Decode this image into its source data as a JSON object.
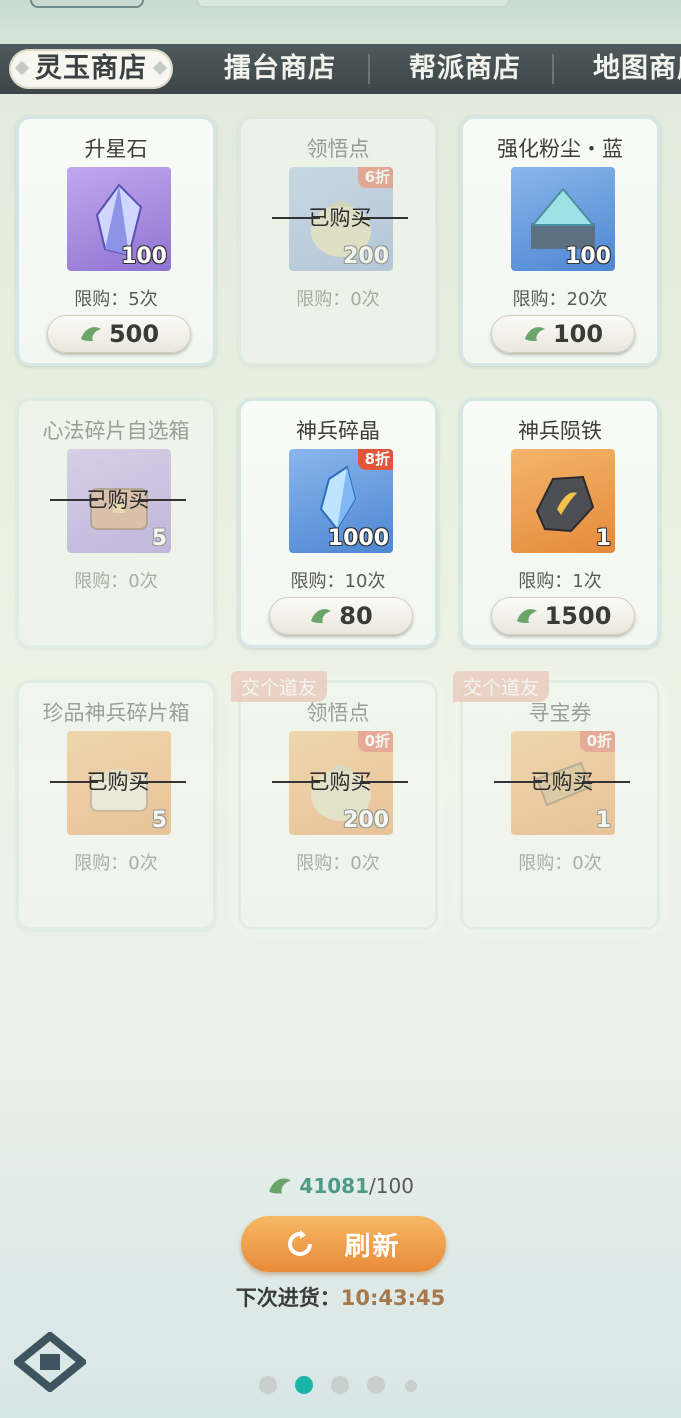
{
  "tabs": [
    {
      "label": "灵玉商店",
      "active": true
    },
    {
      "label": "擂台商店",
      "active": false
    },
    {
      "label": "帮派商店",
      "active": false
    },
    {
      "label": "地图商店",
      "active": false
    }
  ],
  "items": [
    {
      "name": "升星石",
      "qty": "100",
      "limit": "限购：5次",
      "price": "500",
      "discount": "",
      "sold_out": false,
      "icon": "crystal-icon"
    },
    {
      "name": "领悟点",
      "qty": "200",
      "limit": "限购：0次",
      "price": "",
      "discount": "6折",
      "sold_out": true,
      "icon": "pouch-icon"
    },
    {
      "name": "强化粉尘・蓝",
      "qty": "100",
      "limit": "限购：20次",
      "price": "100",
      "discount": "",
      "sold_out": false,
      "icon": "dust-box-icon"
    },
    {
      "name": "心法碎片自选箱",
      "qty": "5",
      "limit": "限购：0次",
      "price": "",
      "discount": "",
      "sold_out": true,
      "icon": "chest-icon"
    },
    {
      "name": "神兵碎晶",
      "qty": "1000",
      "limit": "限购：10次",
      "price": "80",
      "discount": "8折",
      "sold_out": false,
      "icon": "blue-crystal-icon"
    },
    {
      "name": "神兵陨铁",
      "qty": "1",
      "limit": "限购：1次",
      "price": "1500",
      "discount": "",
      "sold_out": false,
      "icon": "meteor-iron-icon"
    },
    {
      "name": "珍品神兵碎片箱",
      "qty": "5",
      "limit": "限购：0次",
      "price": "",
      "discount": "",
      "sold_out": true,
      "icon": "treasure-chest-icon"
    },
    {
      "name": "领悟点",
      "qty": "200",
      "limit": "限购：0次",
      "price": "",
      "discount": "0折",
      "sold_out": true,
      "tag": "交个道友",
      "icon": "pouch-icon"
    },
    {
      "name": "寻宝券",
      "qty": "1",
      "limit": "限购：0次",
      "price": "",
      "discount": "0折",
      "sold_out": true,
      "tag": "交个道友",
      "icon": "ticket-icon"
    }
  ],
  "bought_label": "已购买",
  "currency": {
    "current": "41081",
    "separator_max": "/100",
    "icon": "jade-icon"
  },
  "refresh": {
    "label": "刷新",
    "icon": "refresh-icon"
  },
  "restock": {
    "label": "下次进货：",
    "time": "10:43:45"
  },
  "pagination": {
    "count": 5,
    "active_index": 1
  },
  "colors": {
    "accent": "#e88b38",
    "tab_bar": "#434d50",
    "discount": "#e0553b",
    "currency": "#4f9a86"
  }
}
